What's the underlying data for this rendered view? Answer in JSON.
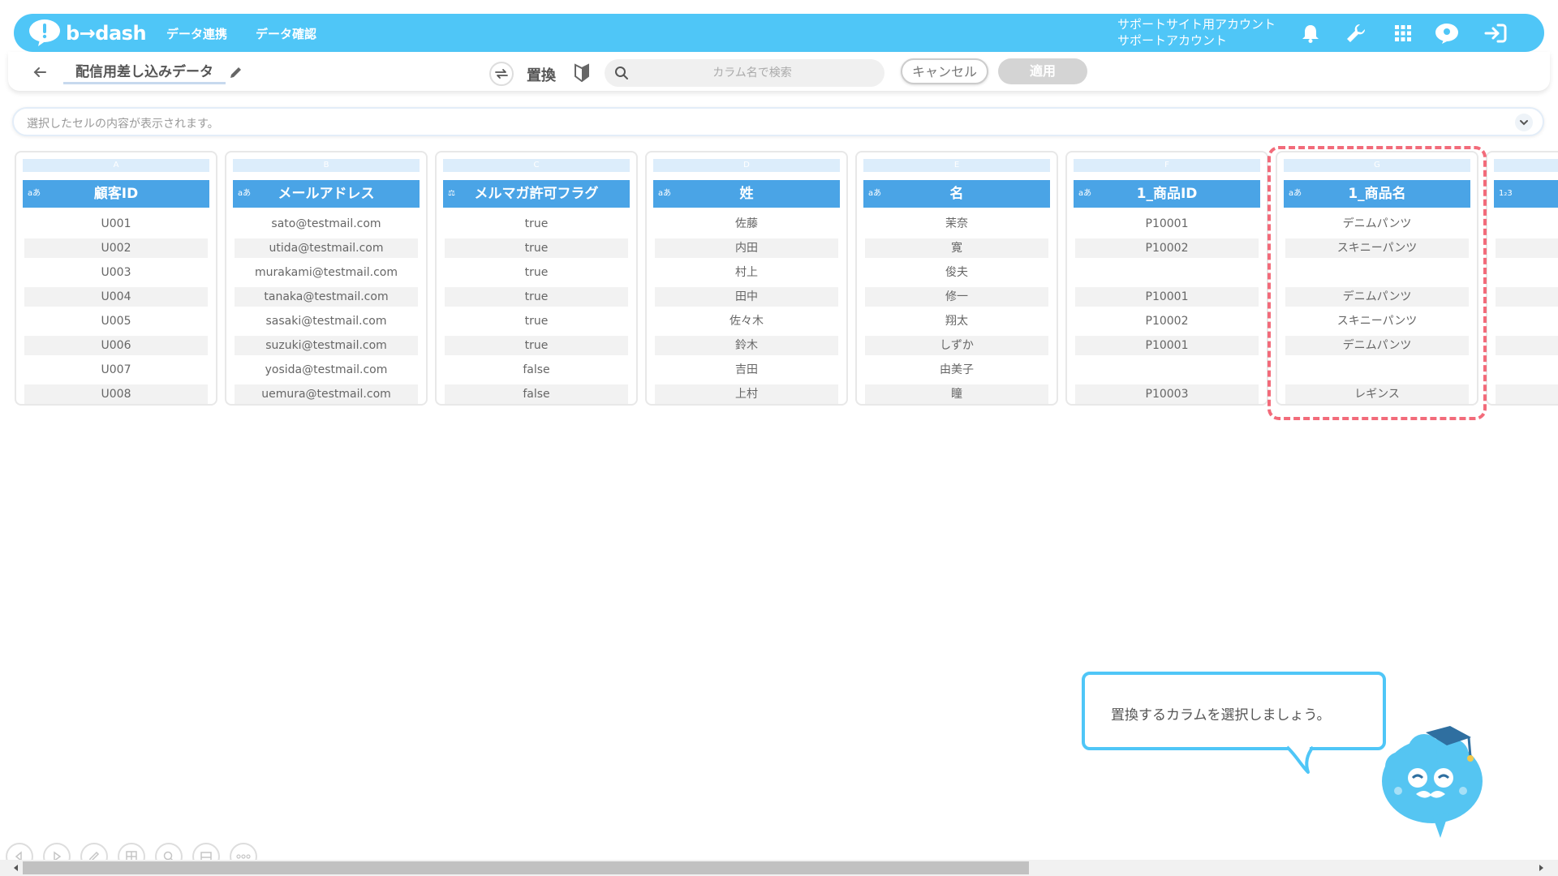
{
  "app": {
    "logo_text": "b→dash",
    "nav": [
      "データ連携",
      "データ確認"
    ],
    "account_line1": "サポートサイト用アカウント",
    "account_line2": "サポートアカウント"
  },
  "toolbar": {
    "datasource_name": "配信用差し込みデータ",
    "mode_label": "置換",
    "search_placeholder": "カラム名で検索",
    "cancel_label": "キャンセル",
    "apply_label": "適用"
  },
  "cellbar": {
    "placeholder": "選択したセルの内容が表示されます。"
  },
  "columns": [
    {
      "letter": "A",
      "type": "aあ",
      "name": "顧客ID",
      "cells": [
        "U001",
        "U002",
        "U003",
        "U004",
        "U005",
        "U006",
        "U007",
        "U008"
      ]
    },
    {
      "letter": "B",
      "type": "aあ",
      "name": "メールアドレス",
      "cells": [
        "sato@testmail.com",
        "utida@testmail.com",
        "murakami@testmail.com",
        "tanaka@testmail.com",
        "sasaki@testmail.com",
        "suzuki@testmail.com",
        "yosida@testmail.com",
        "uemura@testmail.com"
      ]
    },
    {
      "letter": "C",
      "type": "⚖",
      "name": "メルマガ許可フラグ",
      "cells": [
        "true",
        "true",
        "true",
        "true",
        "true",
        "true",
        "false",
        "false"
      ]
    },
    {
      "letter": "D",
      "type": "aあ",
      "name": "姓",
      "cells": [
        "佐藤",
        "内田",
        "村上",
        "田中",
        "佐々木",
        "鈴木",
        "吉田",
        "上村"
      ]
    },
    {
      "letter": "E",
      "type": "aあ",
      "name": "名",
      "cells": [
        "茉奈",
        "寛",
        "俊夫",
        "修一",
        "翔太",
        "しずか",
        "由美子",
        "瞳"
      ]
    },
    {
      "letter": "F",
      "type": "aあ",
      "name": "1_商品ID",
      "cells": [
        "P10001",
        "P10002",
        "",
        "P10001",
        "P10002",
        "P10001",
        "",
        "P10003"
      ]
    },
    {
      "letter": "G",
      "type": "aあ",
      "name": "1_商品名",
      "cells": [
        "デニムパンツ",
        "スキニーパンツ",
        "",
        "デニムパンツ",
        "スキニーパンツ",
        "デニムパンツ",
        "",
        "レギンス"
      ]
    },
    {
      "letter": "H",
      "type": "1₂3",
      "name": "",
      "cells": [
        "",
        "",
        "",
        "",
        "",
        "",
        "",
        ""
      ]
    }
  ],
  "tutorial": {
    "message": "置換するカラムを選択しましょう。"
  },
  "colors": {
    "brand": "#4fc6f7",
    "header": "#4aa4e6",
    "highlight": "#f26b7a"
  }
}
